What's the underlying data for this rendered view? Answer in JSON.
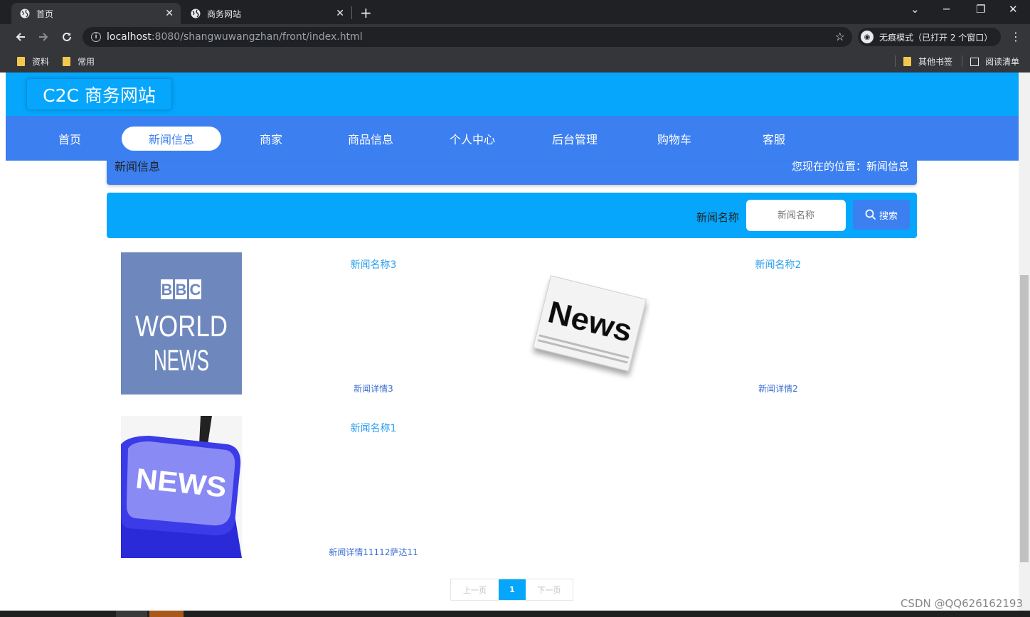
{
  "browser": {
    "tabs": [
      {
        "title": "首页",
        "close": "✕"
      },
      {
        "title": "商务网站",
        "close": "✕"
      }
    ],
    "new_tab": "+",
    "window_controls": {
      "minimize": "─",
      "restore": "❐",
      "close": "✕",
      "dropdown": "⌄"
    },
    "url_host": "localhost",
    "url_rest": ":8080/shangwuwangzhan/front/index.html",
    "incognito_label": "无痕模式（已打开 2 个窗口）",
    "bookmarks_left": [
      "资料",
      "常用"
    ],
    "bookmarks_right": [
      "其他书签",
      "阅读清单"
    ],
    "icons": [
      "back-icon",
      "forward-icon",
      "reload-icon",
      "info-icon",
      "star-icon",
      "incognito-icon",
      "menu-icon",
      "folder-icon",
      "reading-list-icon",
      "globe-icon"
    ]
  },
  "site": {
    "logo": "C2C 商务网站",
    "nav": [
      "首页",
      "新闻信息",
      "商家",
      "商品信息",
      "个人中心",
      "后台管理",
      "购物车",
      "客服"
    ],
    "active_nav": "新闻信息",
    "colors": {
      "header": "#05a6fb",
      "nav": "#3c7ff0",
      "link": "#2a9ff0"
    }
  },
  "breadcrumb": {
    "title": "新闻信息",
    "location": "您现在的位置：新闻信息"
  },
  "search": {
    "label": "新闻名称",
    "placeholder": "新闻名称",
    "button": "搜索"
  },
  "news": [
    {
      "title": "新闻名称3",
      "detail": "新闻详情3",
      "image": "bbc-world-news",
      "image_text": [
        "BBC",
        "WORLD",
        "NEWS"
      ]
    },
    {
      "title": "新闻名称2",
      "detail": "新闻详情2",
      "image": "newspaper",
      "image_text": [
        "News"
      ]
    },
    {
      "title": "新闻名称1",
      "detail": "新闻详情11112萨达11",
      "image": "news-key",
      "image_text": [
        "NEWS"
      ]
    }
  ],
  "pagination": {
    "prev": "上一页",
    "current": "1",
    "next": "下一页"
  },
  "watermark": "CSDN @QQ626162193"
}
